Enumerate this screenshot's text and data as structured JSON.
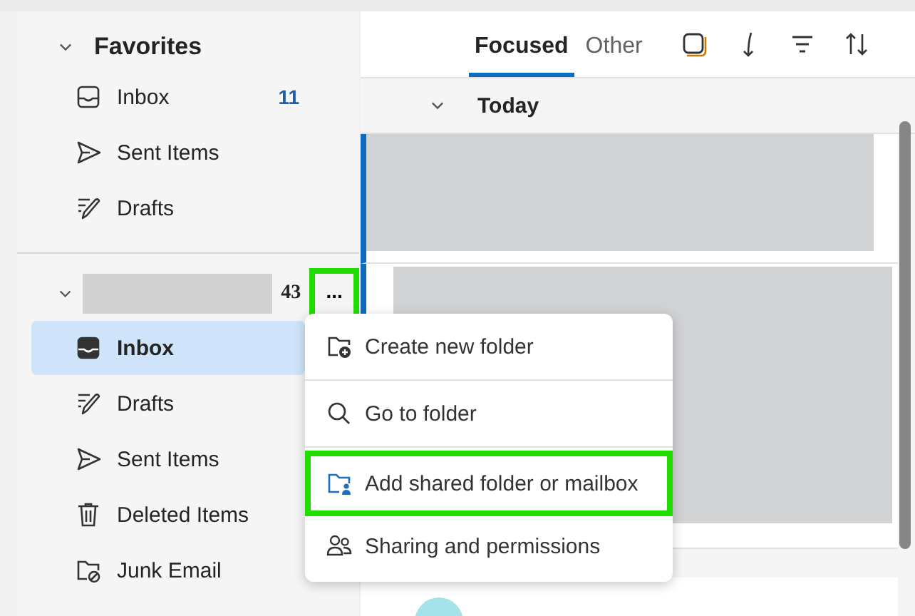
{
  "favorites": {
    "title": "Favorites",
    "expanded": true,
    "items": [
      {
        "label": "Inbox",
        "count": "11",
        "selected": false
      },
      {
        "label": "Sent Items",
        "selected": false
      },
      {
        "label": "Drafts",
        "selected": false
      }
    ]
  },
  "account": {
    "name_tail": "43",
    "expanded": true,
    "more_button": {
      "label": "...",
      "highlighted": true
    },
    "items": [
      {
        "label": "Inbox",
        "selected": true
      },
      {
        "label": "Drafts",
        "selected": false
      },
      {
        "label": "Sent Items",
        "selected": false
      },
      {
        "label": "Deleted Items",
        "selected": false
      },
      {
        "label": "Junk Email",
        "selected": false
      }
    ]
  },
  "tabs": [
    {
      "label": "Focused",
      "selected": true
    },
    {
      "label": "Other",
      "selected": false
    }
  ],
  "group": {
    "label": "Today",
    "expanded": true
  },
  "context_menu": [
    {
      "label": "Create new folder",
      "highlighted": false
    },
    {
      "label": "Go to folder",
      "highlighted": false
    },
    {
      "label": "Add shared folder or mailbox",
      "highlighted": true
    },
    {
      "label": "Sharing and permissions",
      "highlighted": false
    }
  ]
}
